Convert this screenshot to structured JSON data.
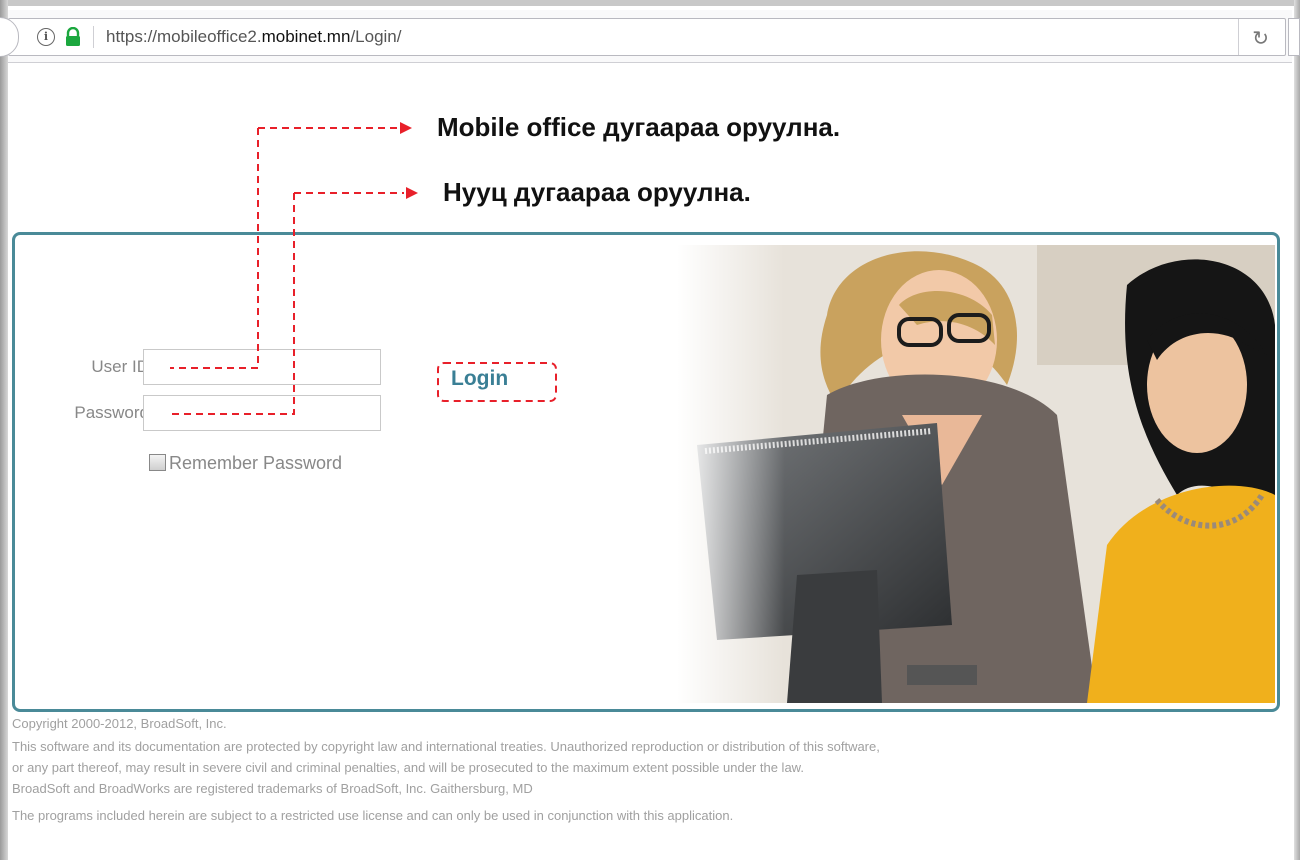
{
  "browser": {
    "url_prefix": "https://mobileoffice2.",
    "url_domain": "mobinet.mn",
    "url_suffix": "/Login/",
    "reload_icon": "reload-icon",
    "info_icon": "info-icon",
    "lock_icon": "lock-icon"
  },
  "annotations": {
    "user_hint": "Mobile office дугаараа оруулна.",
    "password_hint": "Нууц дугаараа оруулна.",
    "guide_color": "#e8202a"
  },
  "login": {
    "user_label": "User ID",
    "password_label": "Password",
    "user_value": "",
    "password_value": "",
    "remember_label": "Remember Password",
    "remember_checked": false,
    "login_button": "Login",
    "accent_color": "#3a7f95"
  },
  "footer": {
    "copyright": "Copyright 2000-2012, BroadSoft, Inc.",
    "notice_lines": [
      "This software and its documentation are protected by copyright law and international treaties. Unauthorized reproduction or distribution of this software,",
      "or any part thereof, may result in severe civil and criminal penalties, and will be prosecuted to the maximum extent possible under the law.",
      "BroadSoft and BroadWorks are registered trademarks of BroadSoft, Inc. Gaithersburg, MD"
    ],
    "license": "The programs included herein are subject to a restricted use license and can only be used in conjunction with this application."
  }
}
